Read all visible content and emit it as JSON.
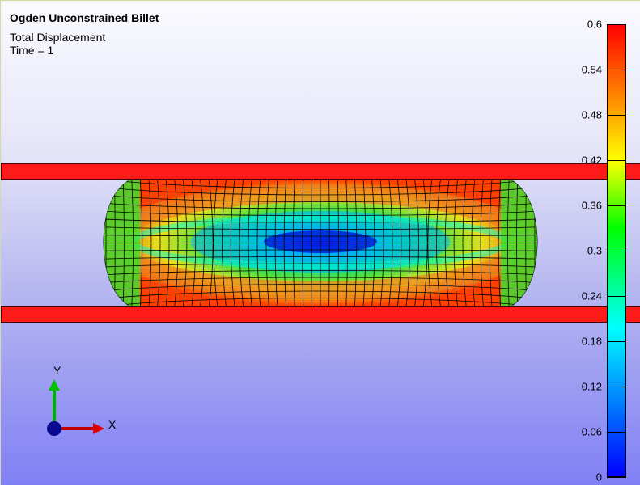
{
  "title": "Ogden Unconstrained Billet",
  "variable": "Total Displacement",
  "time_label": "Time = 1",
  "colorbar": {
    "min": 0,
    "max": 0.6,
    "ticks": [
      "0.6",
      "0.54",
      "0.48",
      "0.42",
      "0.36",
      "0.3",
      "0.24",
      "0.18",
      "0.12",
      "0.06",
      "0"
    ],
    "colormap": [
      "#0000ff",
      "#00ffff",
      "#00ff00",
      "#ffff00",
      "#ff0000"
    ]
  },
  "triad": {
    "x_label": "X",
    "y_label": "Y"
  },
  "colors": {
    "plate": "#ff1a1a",
    "mesh_line": "#000000",
    "x_axis": "#e00000",
    "y_axis": "#00c000",
    "origin": "#000090"
  }
}
